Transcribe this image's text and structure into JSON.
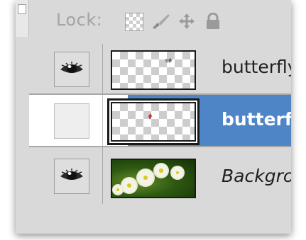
{
  "lock_bar": {
    "label": "Lock:",
    "icons": [
      "lock-transparent-pixels-icon",
      "lock-image-pixels-icon",
      "lock-position-icon",
      "lock-all-icon"
    ]
  },
  "layers": [
    {
      "name": "butterfly",
      "visible": true,
      "selected": false,
      "thumbnail": "transparent-with-butterfly-icon"
    },
    {
      "name": "butterfl",
      "visible": false,
      "selected": true,
      "thumbnail": "transparent-with-red-mark-icon"
    },
    {
      "name": "Backgro",
      "visible": true,
      "selected": false,
      "thumbnail": "daisies-photo-icon"
    }
  ],
  "colors": {
    "panel_bg": "#d9d9d9",
    "selection": "#4e85c6",
    "selected_text": "#ffffff",
    "text": "#1f1f1f"
  }
}
